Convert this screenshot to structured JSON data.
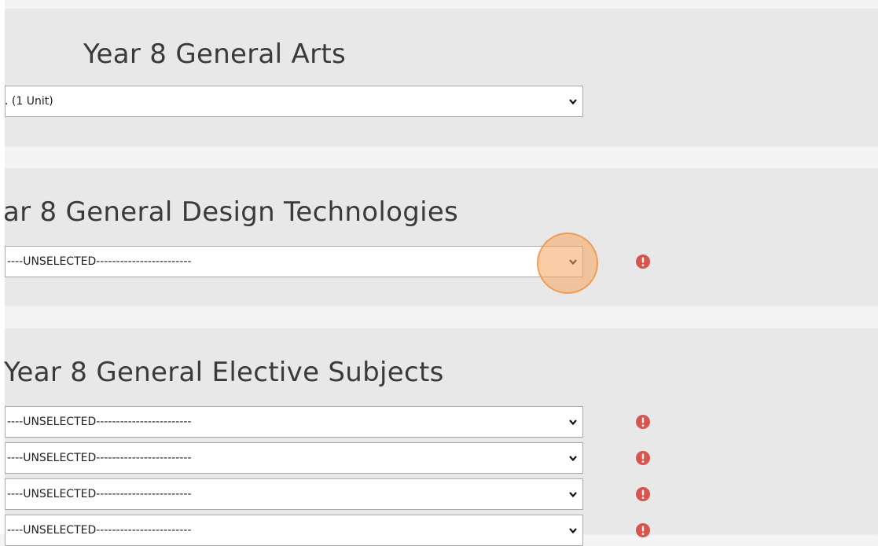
{
  "sections": [
    {
      "title": "Year 8 General Arts",
      "selects": [
        {
          "value": ". (1 Unit)",
          "has_error": false
        }
      ]
    },
    {
      "title": "ar 8 General Design Technologies",
      "selects": [
        {
          "value": "----UNSELECTED------------------------",
          "has_error": true
        }
      ]
    },
    {
      "title": "Year 8 General Elective Subjects",
      "selects": [
        {
          "value": "----UNSELECTED------------------------",
          "has_error": true
        },
        {
          "value": "----UNSELECTED------------------------",
          "has_error": true
        },
        {
          "value": "----UNSELECTED------------------------",
          "has_error": true
        },
        {
          "value": "----UNSELECTED------------------------",
          "has_error": true
        }
      ]
    }
  ],
  "colors": {
    "panel_bg": "#e8e8e8",
    "page_bg": "#f4f4f4",
    "error_icon": "#d9534f",
    "click_highlight": "#f7a45c"
  },
  "icons": {
    "dropdown": "chevron-down-icon",
    "error": "exclamation-circle-icon",
    "click_indicator": "click-highlight"
  }
}
